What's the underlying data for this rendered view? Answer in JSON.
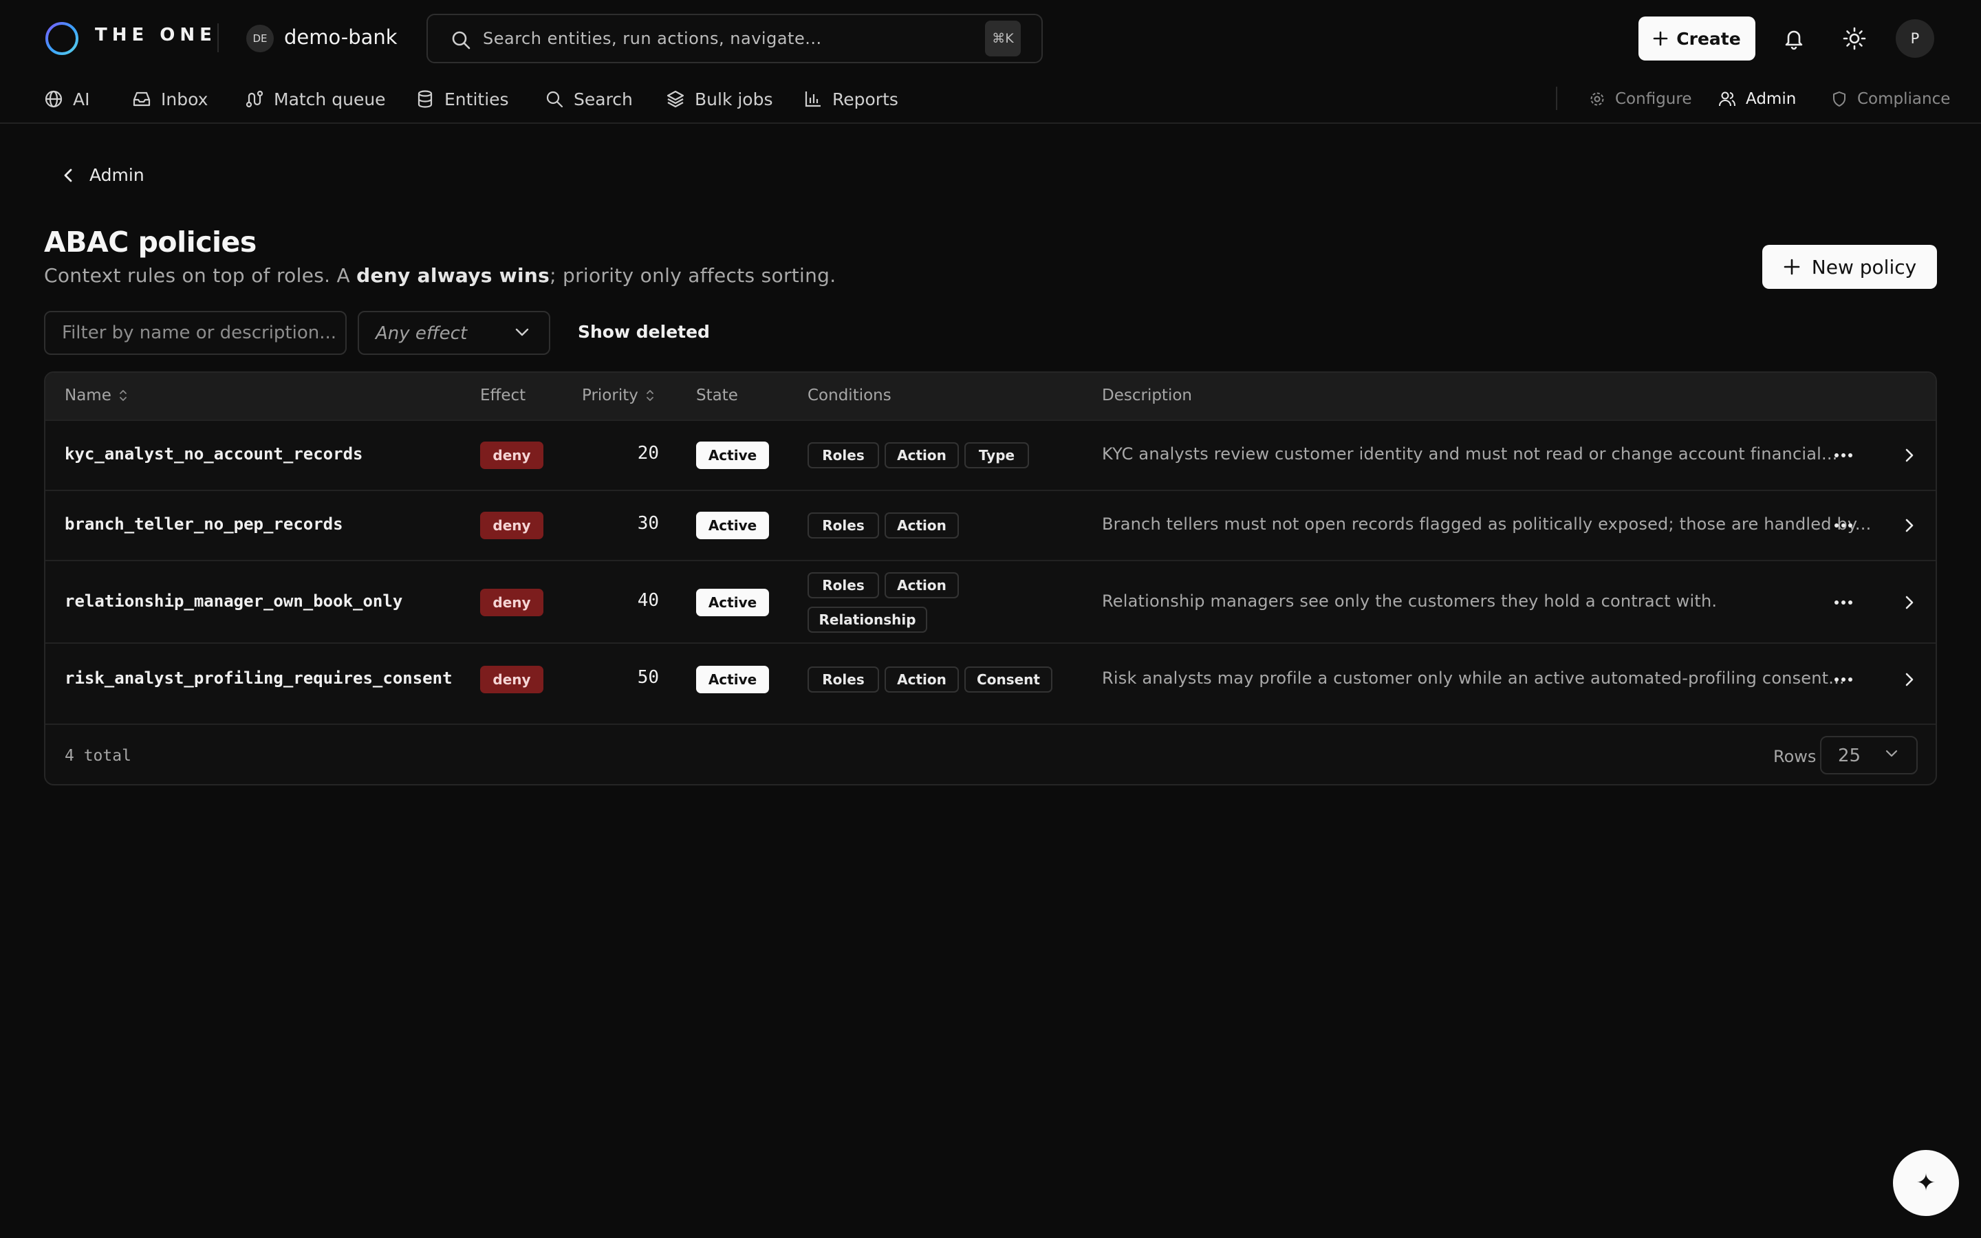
{
  "app": {
    "brand": "THE ONE",
    "tenant_initials": "DE",
    "tenant_name": "demo-bank",
    "search_placeholder": "Search entities, run actions, navigate...",
    "search_shortcut": "⌘K",
    "create_label": "Create",
    "avatar_initial": "P"
  },
  "nav": {
    "left": [
      {
        "label": "AI",
        "icon": "globe-icon"
      },
      {
        "label": "Inbox",
        "icon": "inbox-icon"
      },
      {
        "label": "Match queue",
        "icon": "route-icon"
      },
      {
        "label": "Entities",
        "icon": "database-icon"
      },
      {
        "label": "Search",
        "icon": "search-icon"
      },
      {
        "label": "Bulk jobs",
        "icon": "layers-icon"
      },
      {
        "label": "Reports",
        "icon": "bar-chart-icon"
      }
    ],
    "right": [
      {
        "label": "Configure",
        "icon": "gear-icon",
        "active": false
      },
      {
        "label": "Admin",
        "icon": "users-icon",
        "active": true
      },
      {
        "label": "Compliance",
        "icon": "shield-icon",
        "active": false
      }
    ]
  },
  "page": {
    "back_label": "Admin",
    "title": "ABAC policies",
    "subtitle_prefix": "Context rules on top of roles. A ",
    "subtitle_bold": "deny always wins",
    "subtitle_suffix": "; priority only affects sorting.",
    "new_policy_label": "New policy"
  },
  "filters": {
    "search_placeholder": "Filter by name or description...",
    "effect_value": "Any effect",
    "show_deleted_label": "Show deleted"
  },
  "table": {
    "columns": {
      "name": "Name",
      "effect": "Effect",
      "priority": "Priority",
      "state": "State",
      "conditions": "Conditions",
      "description": "Description"
    },
    "rows": [
      {
        "name": "kyc_analyst_no_account_records",
        "effect": "deny",
        "priority": "20",
        "state": "Active",
        "conditions": [
          "Roles",
          "Action",
          "Type"
        ],
        "description": "KYC analysts review customer identity and must not read or change account financial..."
      },
      {
        "name": "branch_teller_no_pep_records",
        "effect": "deny",
        "priority": "30",
        "state": "Active",
        "conditions": [
          "Roles",
          "Action"
        ],
        "description": "Branch tellers must not open records flagged as politically exposed; those are handled by..."
      },
      {
        "name": "relationship_manager_own_book_only",
        "effect": "deny",
        "priority": "40",
        "state": "Active",
        "conditions": [
          "Roles",
          "Action",
          "Relationship"
        ],
        "description": "Relationship managers see only the customers they hold a contract with."
      },
      {
        "name": "risk_analyst_profiling_requires_consent",
        "effect": "deny",
        "priority": "50",
        "state": "Active",
        "conditions": [
          "Roles",
          "Action",
          "Consent"
        ],
        "description": "Risk analysts may profile a customer only while an active automated-profiling consent..."
      }
    ],
    "total_label": "4 total",
    "rows_label": "Rows",
    "rows_value": "25"
  },
  "colors": {
    "background": "#0c0c0c",
    "deny": "#7c1d1d",
    "primary_button": "#fafafa"
  },
  "fab_icon": "sparkle-icon",
  "fab_glyph": "✦"
}
